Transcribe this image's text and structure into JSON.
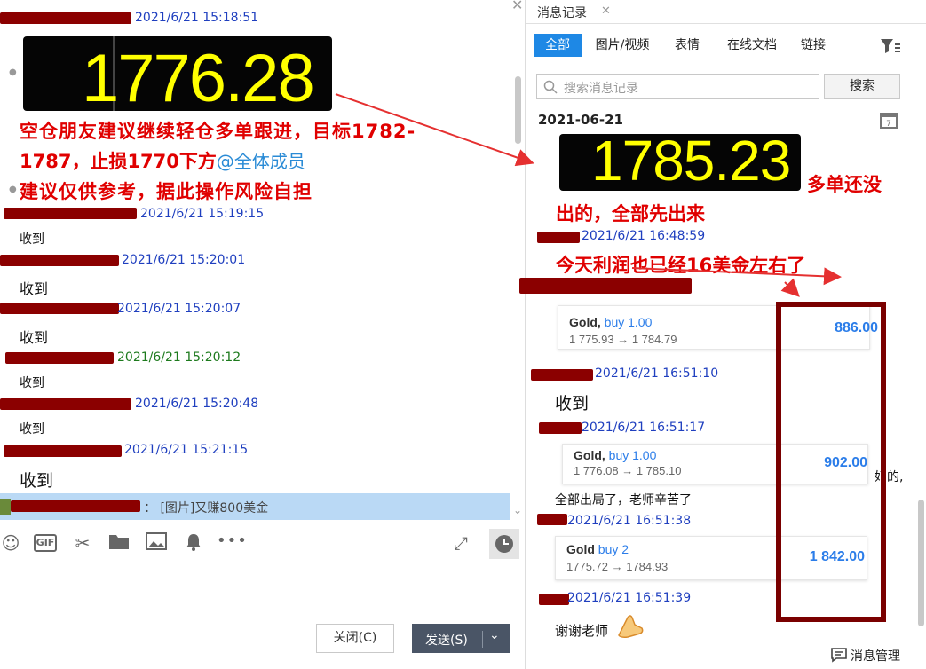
{
  "left_chat": {
    "top_ts": "2021/6/21 15:18:51",
    "ticker": "1776.28",
    "advice": {
      "line1": "空仓朋友建议继续轻仓多单跟进，目标1782-",
      "line2_a": "1787，止损1770下方",
      "mention": "@全体成员",
      "line3": "建议仅供参考，据此操作风险自担"
    },
    "messages": [
      {
        "ts": "2021/6/21 15:19:15",
        "text": "收到"
      },
      {
        "ts": "2021/6/21 15:20:01",
        "text": "收到"
      },
      {
        "ts": "2021/6/21 15:20:07",
        "text": "收到"
      },
      {
        "ts": "2021/6/21 15:20:12",
        "text": "收到"
      },
      {
        "ts": "2021/6/21 15:20:48",
        "text": "收到"
      },
      {
        "ts": "2021/6/21 15:21:15",
        "text": "收到"
      }
    ],
    "notice_bar": "： [图片]又赚800美金",
    "close_btn": "关闭(C)",
    "send_btn": "发送(S)"
  },
  "right_panel": {
    "tab_title": "消息记录",
    "filters": [
      "全部",
      "图片/视频",
      "表情",
      "在线文档",
      "链接"
    ],
    "search_placeholder": "搜索消息记录",
    "search_btn": "搜索",
    "date": "2021-06-21",
    "ticker": "1785.23",
    "red_text_1a": "多单还没",
    "red_text_1b": "出的，全部先出来",
    "ts1": "2021/6/21 16:48:59",
    "red_text_2": "今天利润也已经16美金左右了",
    "card1": {
      "title": "Gold, ",
      "side": "buy 1.00",
      "prices": "1 775.93 → 1 784.79",
      "amount": "886.00"
    },
    "ts2": "2021/6/21 16:51:10",
    "msg2": "收到",
    "ts3": "2021/6/21 16:51:17",
    "card2": {
      "title": "Gold, ",
      "side": "buy 1.00",
      "prices": "1 776.08 → 1 785.10",
      "amount": "902.00"
    },
    "msg3_side": "好的,",
    "msg3": "全部出局了，老师辛苦了",
    "ts4": "2021/6/21 16:51:38",
    "card3": {
      "title": "Gold ",
      "side": "buy 2",
      "prices": "1775.72 → 1784.93",
      "amount": "1 842.00"
    },
    "ts5": "2021/6/21 16:51:39",
    "msg5": "谢谢老师",
    "manage": "消息管理"
  },
  "colors": {
    "accent": "#1e88e5",
    "red": "#e00000",
    "box": "#7a0000",
    "timestamp": "#1f3fbf"
  }
}
